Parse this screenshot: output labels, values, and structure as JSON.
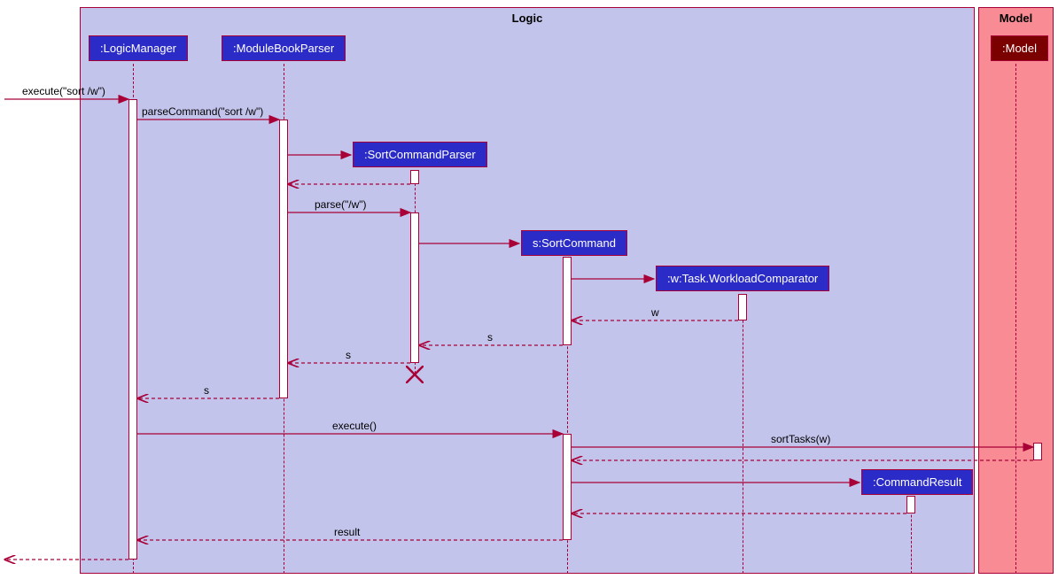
{
  "regions": {
    "logic": {
      "title": "Logic"
    },
    "model": {
      "title": "Model"
    }
  },
  "participants": {
    "logicManager": ":LogicManager",
    "moduleBookParser": ":ModuleBookParser",
    "sortCommandParser": ":SortCommandParser",
    "sortCommand": "s:SortCommand",
    "workloadComparator": ":w:Task.WorkloadComparator",
    "commandResult": ":CommandResult",
    "model": ":Model"
  },
  "messages": {
    "execute1": "execute(\"sort /w\")",
    "parseCommand": "parseCommand(\"sort /w\")",
    "parse": "parse(\"/w\")",
    "w_return": "w",
    "s_return1": "s",
    "s_return2": "s",
    "s_return3": "s",
    "execute2": "execute()",
    "sortTasks": "sortTasks(w)",
    "result": "result"
  },
  "chart_data": {
    "type": "sequence_diagram",
    "regions": [
      {
        "name": "Logic",
        "participants": [
          ":LogicManager",
          ":ModuleBookParser",
          ":SortCommandParser",
          "s:SortCommand",
          ":w:Task.WorkloadComparator",
          ":CommandResult"
        ]
      },
      {
        "name": "Model",
        "participants": [
          ":Model"
        ]
      }
    ],
    "interactions": [
      {
        "from": "caller",
        "to": ":LogicManager",
        "message": "execute(\"sort /w\")",
        "type": "sync"
      },
      {
        "from": ":LogicManager",
        "to": ":ModuleBookParser",
        "message": "parseCommand(\"sort /w\")",
        "type": "sync"
      },
      {
        "from": ":ModuleBookParser",
        "to": ":SortCommandParser",
        "message": "",
        "type": "create"
      },
      {
        "from": ":SortCommandParser",
        "to": ":ModuleBookParser",
        "message": "",
        "type": "return"
      },
      {
        "from": ":ModuleBookParser",
        "to": ":SortCommandParser",
        "message": "parse(\"/w\")",
        "type": "sync"
      },
      {
        "from": ":SortCommandParser",
        "to": "s:SortCommand",
        "message": "",
        "type": "create"
      },
      {
        "from": "s:SortCommand",
        "to": ":w:Task.WorkloadComparator",
        "message": "",
        "type": "create"
      },
      {
        "from": ":w:Task.WorkloadComparator",
        "to": "s:SortCommand",
        "message": "w",
        "type": "return"
      },
      {
        "from": "s:SortCommand",
        "to": ":SortCommandParser",
        "message": "s",
        "type": "return"
      },
      {
        "from": ":SortCommandParser",
        "to": ":ModuleBookParser",
        "message": "s",
        "type": "return"
      },
      {
        "from": ":SortCommandParser",
        "to": null,
        "message": "",
        "type": "destroy"
      },
      {
        "from": ":ModuleBookParser",
        "to": ":LogicManager",
        "message": "s",
        "type": "return"
      },
      {
        "from": ":LogicManager",
        "to": "s:SortCommand",
        "message": "execute()",
        "type": "sync"
      },
      {
        "from": "s:SortCommand",
        "to": ":Model",
        "message": "sortTasks(w)",
        "type": "sync"
      },
      {
        "from": ":Model",
        "to": "s:SortCommand",
        "message": "",
        "type": "return"
      },
      {
        "from": "s:SortCommand",
        "to": ":CommandResult",
        "message": "",
        "type": "create"
      },
      {
        "from": ":CommandResult",
        "to": "s:SortCommand",
        "message": "",
        "type": "return"
      },
      {
        "from": "s:SortCommand",
        "to": ":LogicManager",
        "message": "result",
        "type": "return"
      },
      {
        "from": ":LogicManager",
        "to": "caller",
        "message": "",
        "type": "return"
      }
    ]
  }
}
